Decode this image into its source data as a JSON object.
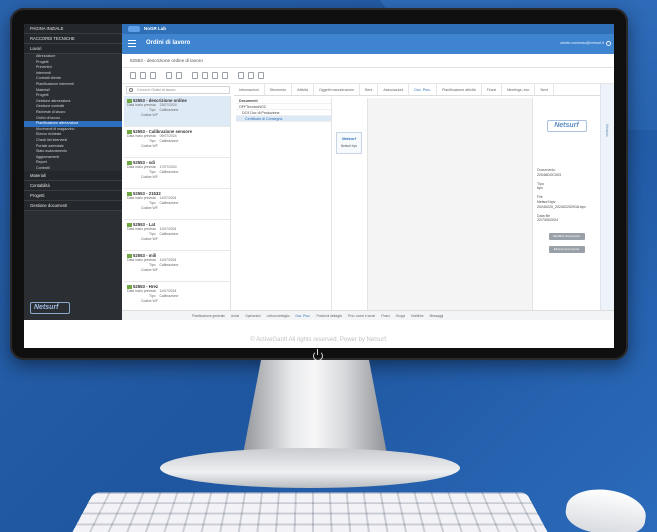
{
  "app": {
    "name": "Netsurf",
    "product_badge": "NoGR Lab",
    "page_title": "Ordini di lavoro",
    "subtitle": "52553 - descrizione ordine di lavoro",
    "user": "utente.connesso@netsurf.it",
    "footer_text": "© ActiveGantt All rights reserved. Power by Netsurf."
  },
  "sidebar": {
    "main_items": [
      {
        "label": "PAGINA INIZIALE"
      },
      {
        "label": "RACCORDI TECNICHE"
      },
      {
        "label": "Lavori"
      }
    ],
    "sub_items": [
      {
        "label": "Attrezzature"
      },
      {
        "label": "Progetti"
      },
      {
        "label": "Preventivi"
      },
      {
        "label": "Interventi"
      },
      {
        "label": "Contratti cliente"
      },
      {
        "label": "Pianificazione interventi"
      },
      {
        "label": "Materiali"
      },
      {
        "label": "Progetti"
      },
      {
        "label": "Gestione attrezzatura"
      },
      {
        "label": "Gestione contratti"
      },
      {
        "label": "Richieste di lavoro"
      },
      {
        "label": "Ordini di lavoro"
      },
      {
        "label": "Pianificazione attrezzatura"
      },
      {
        "label": "Movimenti di magazzino"
      },
      {
        "label": "Elenco richieste"
      },
      {
        "label": "Check list interventi"
      },
      {
        "label": "Portale aziendale"
      },
      {
        "label": "Stato avanzamento"
      },
      {
        "label": "Aggiornamenti"
      },
      {
        "label": "Report"
      },
      {
        "label": "Contratti"
      }
    ],
    "active_sub_index": 12,
    "bottom_items": [
      {
        "label": "Materiali"
      },
      {
        "label": "Contabilità"
      },
      {
        "label": "Progetti"
      },
      {
        "label": "Gestione documenti"
      }
    ],
    "logo_text": "Netsurf"
  },
  "search": {
    "placeholder": "Cerca in Ordini di lavoro"
  },
  "list": {
    "items": [
      {
        "title": "52553 - descrizione ordine",
        "date_label": "Data inizio prevista",
        "date": "23/07/2024",
        "type_label": "Tipo",
        "type": "Calibrazione",
        "code": "Codice WF",
        "selected": true
      },
      {
        "title": "52553 - Calibrazione sensore",
        "date_label": "Data inizio prevista",
        "date": "09/07/2024",
        "type_label": "Tipo",
        "type": "Calibrazione",
        "code": "Codice WF",
        "selected": false
      },
      {
        "title": "52553 - sdi",
        "date_label": "Data inizio prevista",
        "date": "17/07/2024",
        "type_label": "Tipo",
        "type": "Calibrazione",
        "code": "Codice WF",
        "selected": false
      },
      {
        "title": "52553 - 21532",
        "date_label": "Data inizio prevista",
        "date": "11/07/2024",
        "type_label": "Tipo",
        "type": "Calibrazione",
        "code": "Codice WF",
        "selected": false
      },
      {
        "title": "52553 - Lat",
        "date_label": "Data inizio prevista",
        "date": "11/07/2024",
        "type_label": "Tipo",
        "type": "Calibrazione",
        "code": "Codice WF",
        "selected": false
      },
      {
        "title": "52553 - mili",
        "date_label": "Data inizio prevista",
        "date": "11/07/2024",
        "type_label": "Tipo",
        "type": "Calibrazione",
        "code": "Codice WF",
        "selected": false
      },
      {
        "title": "52553 - Hrez",
        "date_label": "Data inizio prevista",
        "date": "11/07/2024",
        "type_label": "Tipo",
        "type": "Calibrazione",
        "code": "Codice WF",
        "selected": false
      }
    ]
  },
  "tabs": [
    {
      "label": "Informazioni",
      "active": false
    },
    {
      "label": "Strumento",
      "active": false
    },
    {
      "label": "Attività",
      "active": false
    },
    {
      "label": "Oggetti manutenzione",
      "active": false
    },
    {
      "label": "Beni",
      "active": false
    },
    {
      "label": "Associazioni",
      "active": false
    },
    {
      "label": "Doc. Proc.",
      "active": true
    },
    {
      "label": "Pianificazione attività",
      "active": false
    },
    {
      "label": "Flussi",
      "active": false
    },
    {
      "label": "Meetings, eco",
      "active": false
    },
    {
      "label": "Next",
      "active": false
    }
  ],
  "tree": {
    "header": "Documenti",
    "rows": [
      {
        "label": "OFFTecnicoNOC",
        "selected": false
      },
      {
        "label": "DC9 Doc di Produzione",
        "selected": false
      },
      {
        "label": "Certificato di Consegna",
        "selected": true
      }
    ]
  },
  "thumbnail": {
    "title": "Netsurf",
    "caption": "Netsurf.bpv"
  },
  "document": {
    "logo": "Netsurf",
    "meta": [
      {
        "label": "Documento",
        "value": "22046DOC003"
      },
      {
        "label": "Tipo",
        "value": "bpv"
      },
      {
        "label": "File",
        "value": "Netsurf.bpv"
      },
      {
        "label": "",
        "value": "20240220_202402202918.bpv"
      },
      {
        "label": "Data file",
        "value": "22/7/05/2024"
      }
    ],
    "buttons": [
      {
        "label": "Modifica documento"
      },
      {
        "label": "Elimina documento"
      }
    ]
  },
  "right_strip_label": "Metadati",
  "bottom_tabs": [
    {
      "label": "Pianificazione generale",
      "active": false
    },
    {
      "label": "Avvisi",
      "active": false
    },
    {
      "label": "Operazioni",
      "active": false
    },
    {
      "label": "Lettura dettaglio",
      "active": false
    },
    {
      "label": "Doc. Proc.",
      "active": true
    },
    {
      "label": "Posizioni dettaglio",
      "active": false
    },
    {
      "label": "Proc. lavori e lavori",
      "active": false
    },
    {
      "label": "Flussi",
      "active": false
    },
    {
      "label": "Gruppi",
      "active": false
    },
    {
      "label": "Notifiche",
      "active": false
    },
    {
      "label": "Messaggi",
      "active": false
    }
  ],
  "colors": {
    "header_blue": "#3e84cf",
    "topbar_blue": "#2f6fb7",
    "sidebar_dark": "#2b2e33",
    "active_blue": "#2d6fbf",
    "background_blue": "#2a63ad"
  }
}
